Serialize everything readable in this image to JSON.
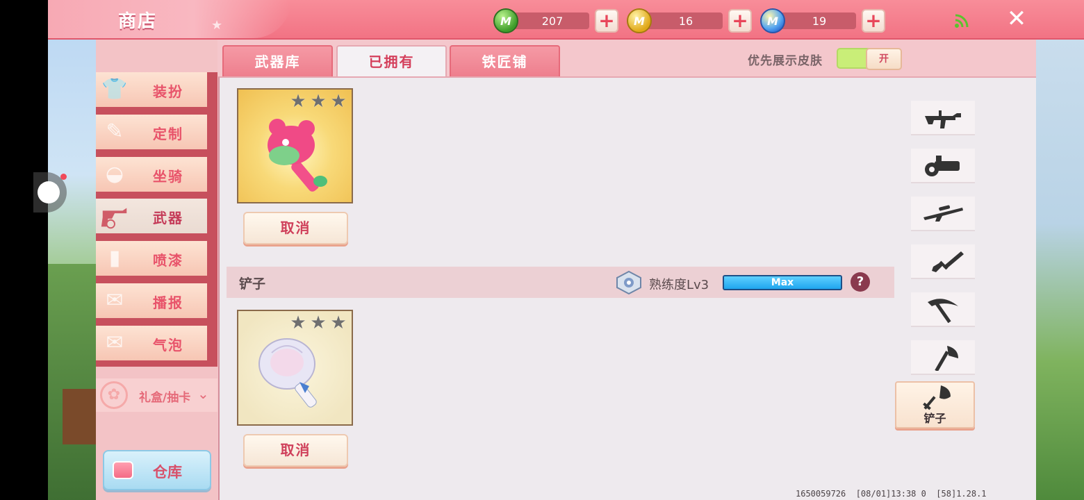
{
  "header": {
    "title": "商店",
    "close_icon": "close-icon",
    "signal_icon": "signal-icon"
  },
  "currencies": [
    {
      "icon": "green-gem-icon",
      "amount": "207"
    },
    {
      "icon": "gold-coin-icon",
      "amount": "16"
    },
    {
      "icon": "blue-coin-icon",
      "amount": "19"
    }
  ],
  "sidebar": {
    "items": [
      {
        "label": "装扮",
        "icon": "shirt-icon"
      },
      {
        "label": "定制",
        "icon": "tools-icon"
      },
      {
        "label": "坐骑",
        "icon": "mount-icon"
      },
      {
        "label": "武器",
        "icon": "revolver-icon",
        "active": true
      },
      {
        "label": "喷漆",
        "icon": "spray-can-icon"
      },
      {
        "label": "播报",
        "icon": "broadcast-icon"
      },
      {
        "label": "气泡",
        "icon": "bubble-icon"
      }
    ],
    "gift": {
      "label": "礼盒/抽卡",
      "icon": "gift-icon"
    },
    "storage": {
      "label": "仓库",
      "icon": "chest-icon"
    }
  },
  "tabs": [
    {
      "label": "武器库"
    },
    {
      "label": "已拥有",
      "active": true
    },
    {
      "label": "铁匠铺"
    }
  ],
  "skin_toggle": {
    "label": "优先展示皮肤",
    "state": "开"
  },
  "items": [
    {
      "art": "pink-hammer-icon",
      "stars": 3,
      "button": "取消",
      "bg": "gold"
    },
    {
      "art": "shell-shovel-icon",
      "stars": 3,
      "button": "取消",
      "bg": "cream"
    }
  ],
  "weapon_section": {
    "name": "铲子",
    "proficiency_label": "熟练度Lv3",
    "bar_label": "Max",
    "bar_fill": 1.0,
    "help": "?"
  },
  "categories": [
    {
      "icon": "smg-icon"
    },
    {
      "icon": "minigun-icon"
    },
    {
      "icon": "sniper-rifle-icon"
    },
    {
      "icon": "knife-icon"
    },
    {
      "icon": "pickaxe-icon"
    },
    {
      "icon": "axe-icon"
    },
    {
      "icon": "shovel-icon",
      "label": "铲子",
      "active": true
    }
  ],
  "footer": {
    "info": "1650059726  [08/01]13:38 0  [58]1.28.1"
  },
  "colors": {
    "topbar": "#f27384",
    "accent_red": "#d43f5b",
    "content_bg": "#eeeaee",
    "progress_blue": "#1fa5ef"
  }
}
